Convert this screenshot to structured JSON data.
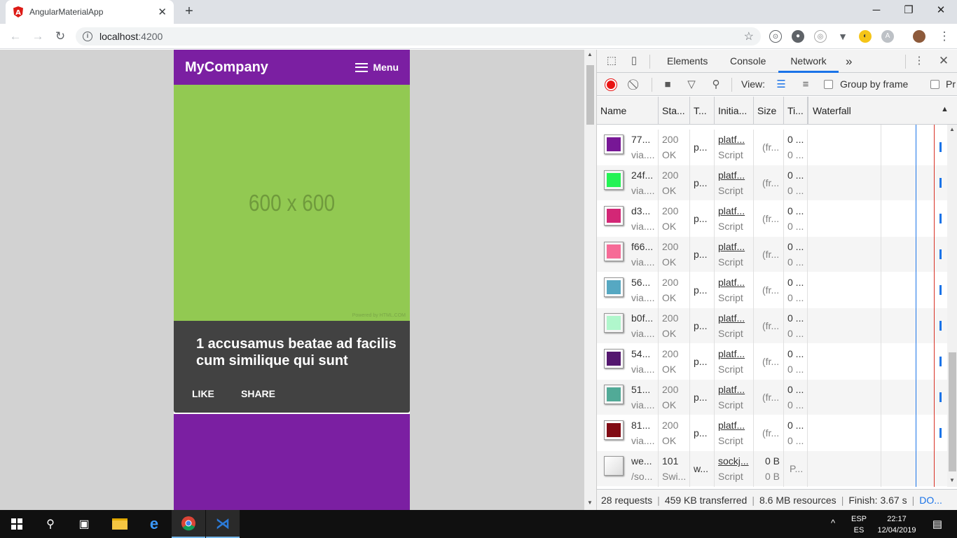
{
  "browser": {
    "tab_title": "AngularMaterialApp",
    "tab_close": "✕",
    "new_tab": "+",
    "url_host": "localhost",
    "url_port": ":4200",
    "window_controls": [
      "─",
      "❐",
      "✕"
    ]
  },
  "app": {
    "brand": "MyCompany",
    "menu_label": "Menu",
    "placeholder_text": "600 x 600",
    "placeholder_powered": "Powered by HTML.COM",
    "card_title": "1 accusamus beatae ad facilis cum similique qui sunt",
    "like_label": "LIKE",
    "share_label": "SHARE",
    "image_color": "#92c952",
    "appbar_color": "#7b1fa2"
  },
  "devtools": {
    "tabs": [
      "Elements",
      "Console",
      "Network"
    ],
    "active_tab": "Network",
    "more_tabs": "»",
    "view_label": "View:",
    "group_by_frame": "Group by frame",
    "preserve_log": "Pr",
    "columns": [
      "Name",
      "Sta...",
      "T...",
      "Initia...",
      "Size",
      "Ti...",
      "Waterfall"
    ],
    "rows": [
      {
        "name": "77...",
        "sub": "via....",
        "status": "200",
        "status_text": "OK",
        "type": "p...",
        "initiator": "platf...",
        "init_type": "Script",
        "size": "(fr...",
        "time": "0 ...",
        "time2": "0 ...",
        "color": "#771796"
      },
      {
        "name": "24f...",
        "sub": "via....",
        "status": "200",
        "status_text": "OK",
        "type": "p...",
        "initiator": "platf...",
        "init_type": "Script",
        "size": "(fr...",
        "time": "0 ...",
        "time2": "0 ...",
        "color": "#24f355"
      },
      {
        "name": "d3...",
        "sub": "via....",
        "status": "200",
        "status_text": "OK",
        "type": "p...",
        "initiator": "platf...",
        "init_type": "Script",
        "size": "(fr...",
        "time": "0 ...",
        "time2": "0 ...",
        "color": "#d32776"
      },
      {
        "name": "f66...",
        "sub": "via....",
        "status": "200",
        "status_text": "OK",
        "type": "p...",
        "initiator": "platf...",
        "init_type": "Script",
        "size": "(fr...",
        "time": "0 ...",
        "time2": "0 ...",
        "color": "#f66b97"
      },
      {
        "name": "56...",
        "sub": "via....",
        "status": "200",
        "status_text": "OK",
        "type": "p...",
        "initiator": "platf...",
        "init_type": "Script",
        "size": "(fr...",
        "time": "0 ...",
        "time2": "0 ...",
        "color": "#56a8c2"
      },
      {
        "name": "b0f...",
        "sub": "via....",
        "status": "200",
        "status_text": "OK",
        "type": "p...",
        "initiator": "platf...",
        "init_type": "Script",
        "size": "(fr...",
        "time": "0 ...",
        "time2": "0 ...",
        "color": "#b0f7cc"
      },
      {
        "name": "54...",
        "sub": "via....",
        "status": "200",
        "status_text": "OK",
        "type": "p...",
        "initiator": "platf...",
        "init_type": "Script",
        "size": "(fr...",
        "time": "0 ...",
        "time2": "0 ...",
        "color": "#54176f"
      },
      {
        "name": "51...",
        "sub": "via....",
        "status": "200",
        "status_text": "OK",
        "type": "p...",
        "initiator": "platf...",
        "init_type": "Script",
        "size": "(fr...",
        "time": "0 ...",
        "time2": "0 ...",
        "color": "#51aa97"
      },
      {
        "name": "81...",
        "sub": "via....",
        "status": "200",
        "status_text": "OK",
        "type": "p...",
        "initiator": "platf...",
        "init_type": "Script",
        "size": "(fr...",
        "time": "0 ...",
        "time2": "0 ...",
        "color": "#810b14"
      },
      {
        "name": "we...",
        "sub": "/so...",
        "status": "101",
        "status_text": "Swi...",
        "type": "w...",
        "initiator": "sockj...",
        "init_type": "Script",
        "size": "0 B",
        "size2": "0 B",
        "time": "P...",
        "time2": "",
        "color": "#ffffff"
      }
    ],
    "status": {
      "requests": "28 requests",
      "transferred": "459 KB transferred",
      "resources": "8.6 MB resources",
      "finish": "Finish: 3.67 s",
      "dom": "DO..."
    }
  },
  "taskbar": {
    "lang_top": "ESP",
    "lang_bottom": "ES",
    "time": "22:17",
    "date": "12/04/2019"
  }
}
